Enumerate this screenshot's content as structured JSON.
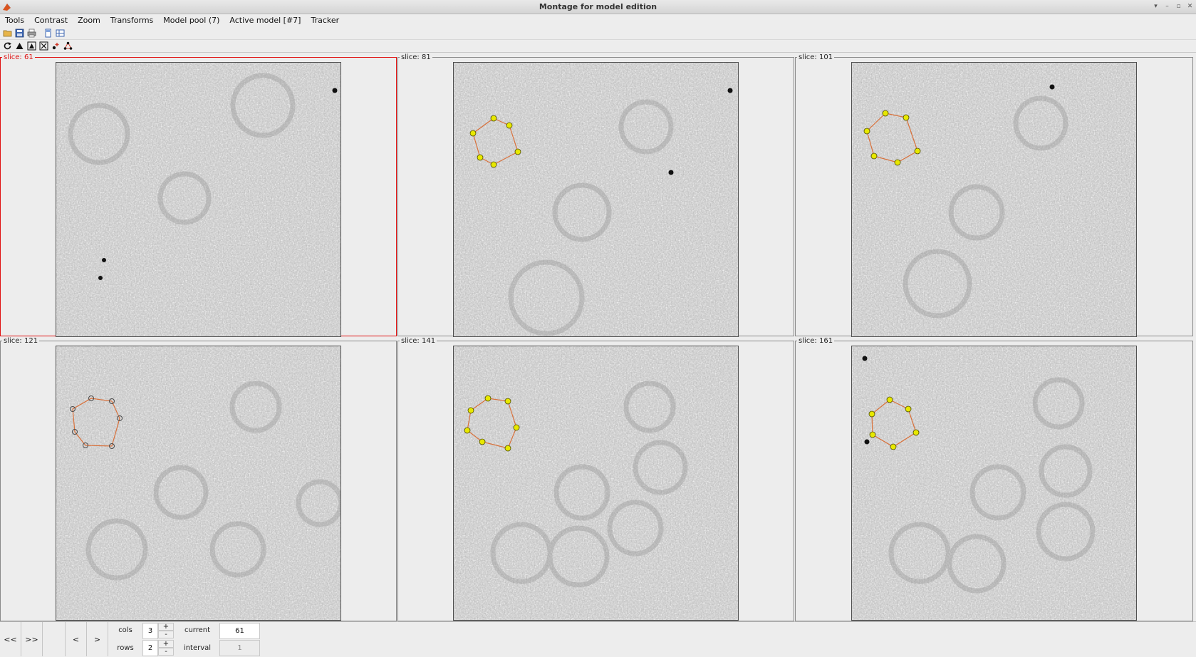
{
  "window": {
    "title": "Montage for model edition",
    "controls": [
      "▾",
      "–",
      "▫",
      "✕"
    ]
  },
  "menu": [
    {
      "label": "Tools"
    },
    {
      "label": "Contrast"
    },
    {
      "label": "Zoom"
    },
    {
      "label": "Transforms"
    },
    {
      "label": "Model pool (7)"
    },
    {
      "label": "Active model [#7]"
    },
    {
      "label": "Tracker"
    }
  ],
  "toolbar1": [
    {
      "icon": "open-folder-icon"
    },
    {
      "icon": "save-icon"
    },
    {
      "icon": "print-icon"
    },
    {
      "icon": "single-view-icon"
    },
    {
      "icon": "grid-view-icon"
    }
  ],
  "toolbar2": [
    {
      "icon": "refresh-icon"
    },
    {
      "icon": "triangle-icon"
    },
    {
      "icon": "triangle-box-icon"
    },
    {
      "icon": "fit-icon"
    },
    {
      "icon": "add-point-icon"
    },
    {
      "icon": "point-network-icon"
    }
  ],
  "panels": [
    {
      "label": "slice: 61",
      "active": true
    },
    {
      "label": "slice: 81",
      "active": false
    },
    {
      "label": "slice: 101",
      "active": false
    },
    {
      "label": "slice: 121",
      "active": false
    },
    {
      "label": "slice: 141",
      "active": false
    },
    {
      "label": "slice: 161",
      "active": false
    }
  ],
  "colors": {
    "active_border": "#e01010",
    "model_point": "#e8e800",
    "model_line": "#d8703a",
    "marker": "#111111"
  },
  "bottom": {
    "first_label": "<<",
    "last_label": ">>",
    "prev_label": "<",
    "next_label": ">",
    "cols_label": "cols",
    "cols_value": "3",
    "rows_label": "rows",
    "rows_value": "2",
    "plus_label": "+",
    "minus_label": "-",
    "current_label": "current",
    "current_value": "61",
    "interval_label": "interval",
    "interval_value": "1"
  }
}
